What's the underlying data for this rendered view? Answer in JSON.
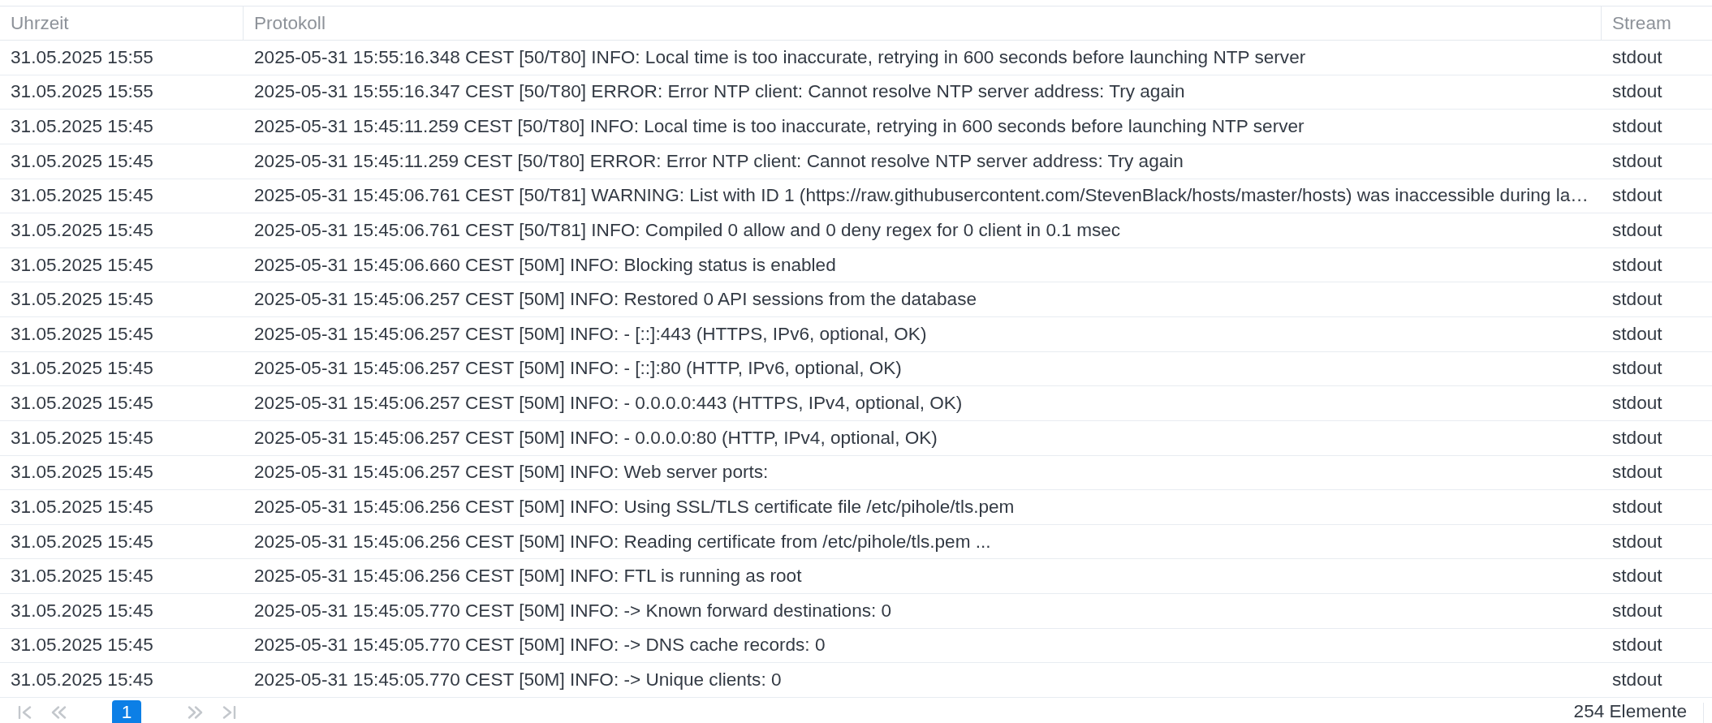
{
  "table": {
    "columns": [
      {
        "label": "Uhrzeit"
      },
      {
        "label": "Protokoll"
      },
      {
        "label": "Stream"
      }
    ],
    "rows": [
      {
        "time": "31.05.2025 15:55",
        "message": "2025-05-31 15:55:16.348 CEST [50/T80] INFO: Local time is too inaccurate, retrying in 600 seconds before launching NTP server",
        "stream": "stdout"
      },
      {
        "time": "31.05.2025 15:55",
        "message": "2025-05-31 15:55:16.347 CEST [50/T80] ERROR: Error NTP client: Cannot resolve NTP server address: Try again",
        "stream": "stdout"
      },
      {
        "time": "31.05.2025 15:45",
        "message": "2025-05-31 15:45:11.259 CEST [50/T80] INFO: Local time is too inaccurate, retrying in 600 seconds before launching NTP server",
        "stream": "stdout"
      },
      {
        "time": "31.05.2025 15:45",
        "message": "2025-05-31 15:45:11.259 CEST [50/T80] ERROR: Error NTP client: Cannot resolve NTP server address: Try again",
        "stream": "stdout"
      },
      {
        "time": "31.05.2025 15:45",
        "message": "2025-05-31 15:45:06.761 CEST [50/T81] WARNING: List with ID 1 (https://raw.githubusercontent.com/StevenBlack/hosts/master/hosts) was inaccessible during la…",
        "stream": "stdout"
      },
      {
        "time": "31.05.2025 15:45",
        "message": "2025-05-31 15:45:06.761 CEST [50/T81] INFO: Compiled 0 allow and 0 deny regex for 0 client in 0.1 msec",
        "stream": "stdout"
      },
      {
        "time": "31.05.2025 15:45",
        "message": "2025-05-31 15:45:06.660 CEST [50M] INFO: Blocking status is enabled",
        "stream": "stdout"
      },
      {
        "time": "31.05.2025 15:45",
        "message": "2025-05-31 15:45:06.257 CEST [50M] INFO: Restored 0 API sessions from the database",
        "stream": "stdout"
      },
      {
        "time": "31.05.2025 15:45",
        "message": "2025-05-31 15:45:06.257 CEST [50M] INFO: - [::]:443 (HTTPS, IPv6, optional, OK)",
        "stream": "stdout"
      },
      {
        "time": "31.05.2025 15:45",
        "message": "2025-05-31 15:45:06.257 CEST [50M] INFO: - [::]:80 (HTTP, IPv6, optional, OK)",
        "stream": "stdout"
      },
      {
        "time": "31.05.2025 15:45",
        "message": "2025-05-31 15:45:06.257 CEST [50M] INFO: - 0.0.0.0:443 (HTTPS, IPv4, optional, OK)",
        "stream": "stdout"
      },
      {
        "time": "31.05.2025 15:45",
        "message": "2025-05-31 15:45:06.257 CEST [50M] INFO: - 0.0.0.0:80 (HTTP, IPv4, optional, OK)",
        "stream": "stdout"
      },
      {
        "time": "31.05.2025 15:45",
        "message": "2025-05-31 15:45:06.257 CEST [50M] INFO: Web server ports:",
        "stream": "stdout"
      },
      {
        "time": "31.05.2025 15:45",
        "message": "2025-05-31 15:45:06.256 CEST [50M] INFO: Using SSL/TLS certificate file /etc/pihole/tls.pem",
        "stream": "stdout"
      },
      {
        "time": "31.05.2025 15:45",
        "message": "2025-05-31 15:45:06.256 CEST [50M] INFO: Reading certificate from /etc/pihole/tls.pem ...",
        "stream": "stdout"
      },
      {
        "time": "31.05.2025 15:45",
        "message": "2025-05-31 15:45:06.256 CEST [50M] INFO: FTL is running as root",
        "stream": "stdout"
      },
      {
        "time": "31.05.2025 15:45",
        "message": "2025-05-31 15:45:05.770 CEST [50M] INFO: -> Known forward destinations: 0",
        "stream": "stdout"
      },
      {
        "time": "31.05.2025 15:45",
        "message": "2025-05-31 15:45:05.770 CEST [50M] INFO: -> DNS cache records: 0",
        "stream": "stdout"
      },
      {
        "time": "31.05.2025 15:45",
        "message": "2025-05-31 15:45:05.770 CEST [50M] INFO: -> Unique clients: 0",
        "stream": "stdout"
      }
    ]
  },
  "pagination": {
    "nav_before": [
      {
        "kind": "first",
        "disabled": true
      },
      {
        "kind": "previous",
        "disabled": true
      }
    ],
    "pages": [
      {
        "label": "1",
        "selected": true
      }
    ],
    "nav_after": [
      {
        "kind": "next",
        "disabled": true
      },
      {
        "kind": "last",
        "disabled": true
      }
    ],
    "item_count": "254 Elemente"
  }
}
